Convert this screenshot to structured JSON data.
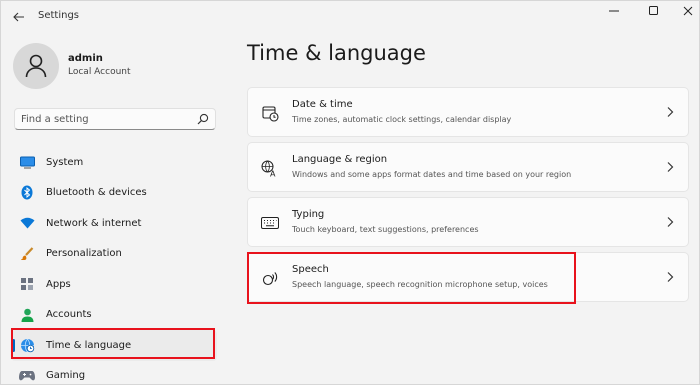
{
  "window": {
    "app_title": "Settings"
  },
  "user": {
    "name": "admin",
    "account_type": "Local Account"
  },
  "search": {
    "placeholder": "Find a setting"
  },
  "sidebar": {
    "items": [
      {
        "label": "System",
        "icon": "monitor-icon",
        "color": "#0a78d7"
      },
      {
        "label": "Bluetooth & devices",
        "icon": "bluetooth-icon",
        "color": "#0a78d7"
      },
      {
        "label": "Network & internet",
        "icon": "wifi-icon",
        "color": "#0a78d7"
      },
      {
        "label": "Personalization",
        "icon": "brush-icon",
        "color": "#d97706"
      },
      {
        "label": "Apps",
        "icon": "apps-icon",
        "color": "#4b5563"
      },
      {
        "label": "Accounts",
        "icon": "person-icon",
        "color": "#16a34a"
      },
      {
        "label": "Time & language",
        "icon": "globe-clock-icon",
        "color": "#0a78d7",
        "selected": true
      },
      {
        "label": "Gaming",
        "icon": "gamepad-icon",
        "color": "#4b5563"
      }
    ]
  },
  "main": {
    "title": "Time & language",
    "cards": [
      {
        "title": "Date & time",
        "subtitle": "Time zones, automatic clock settings, calendar display",
        "icon": "calendar-clock-icon"
      },
      {
        "title": "Language & region",
        "subtitle": "Windows and some apps format dates and time based on your region",
        "icon": "language-icon"
      },
      {
        "title": "Typing",
        "subtitle": "Touch keyboard, text suggestions, preferences",
        "icon": "keyboard-icon"
      },
      {
        "title": "Speech",
        "subtitle": "Speech language, speech recognition microphone setup, voices",
        "icon": "speech-icon"
      }
    ]
  },
  "colors": {
    "accent": "#0067c0",
    "highlight": "#e8121c"
  }
}
